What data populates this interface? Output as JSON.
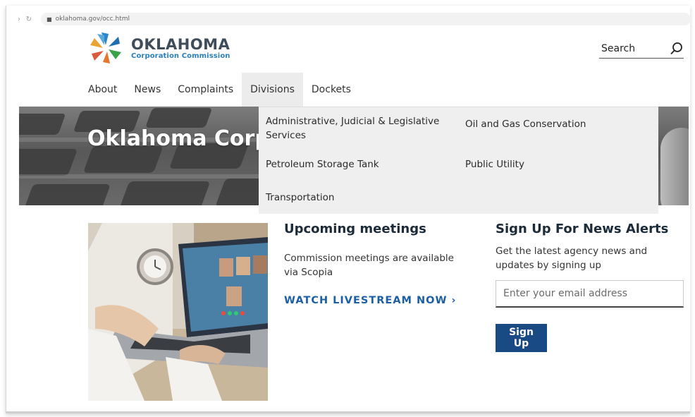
{
  "browser": {
    "url": "oklahoma.gov/occ.html"
  },
  "logo": {
    "title": "OKLAHOMA",
    "subtitle": "Corporation Commission"
  },
  "search": {
    "label": "Search"
  },
  "nav": {
    "items": [
      {
        "label": "About"
      },
      {
        "label": "News"
      },
      {
        "label": "Complaints"
      },
      {
        "label": "Divisions",
        "active": true
      },
      {
        "label": "Dockets"
      }
    ]
  },
  "hero": {
    "title": "Oklahoma Corp"
  },
  "dropdown": {
    "items": [
      {
        "label": "Administrative, Judicial & Legislative Services"
      },
      {
        "label": "Oil and Gas Conservation"
      },
      {
        "label": "Petroleum Storage Tank"
      },
      {
        "label": "Public Utility"
      },
      {
        "label": "Transportation"
      }
    ]
  },
  "meetings": {
    "title": "Upcoming meetings",
    "text": "Commission meetings are available via Scopia",
    "link": "WATCH LIVESTREAM NOW ›"
  },
  "newsletter": {
    "title": "Sign Up For News Alerts",
    "text": "Get the latest agency news and updates by signing up",
    "placeholder": "Enter your email address",
    "button": "Sign Up"
  },
  "colors": {
    "brand_blue": "#1a4a84",
    "link_blue": "#1c5fa4",
    "logo_text": "#3f4d5a",
    "dropdown_bg": "#efefef"
  }
}
